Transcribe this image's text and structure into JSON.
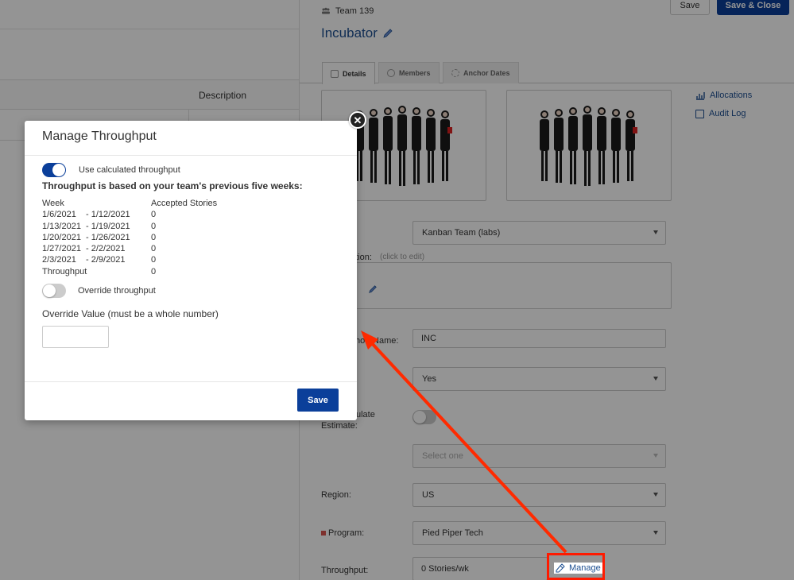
{
  "background": {
    "table_header": "Description"
  },
  "panel": {
    "team_label": "Team 139",
    "team_name": "Incubator",
    "save_label": "Save",
    "save_close_label": "Save & Close",
    "tabs": [
      {
        "label": "Details"
      },
      {
        "label": "Members"
      },
      {
        "label": "Anchor Dates"
      }
    ],
    "side_links": [
      {
        "label": "Allocations"
      },
      {
        "label": "Audit Log"
      }
    ],
    "team_type_value": "Kanban Team (labs)",
    "description_label_partial": "ption:",
    "description_hint": "(click to edit)",
    "description_value_partial": "or",
    "short_name_label_partial": "hort Name:",
    "short_name_value": "INC",
    "active_value": "Yes",
    "auto_calc_label_partial": "ulate",
    "auto_calc_label_line2": "Estimate:",
    "select_placeholder": "Select one",
    "region_label": "Region:",
    "region_value": "US",
    "program_label": "Program:",
    "program_value": "Pied Piper Tech",
    "throughput_label": "Throughput:",
    "throughput_value": "0 Stories/wk",
    "manage_label": "Manage"
  },
  "modal": {
    "title": "Manage Throughput",
    "close_glyph": "✕",
    "use_calc_label": "Use calculated throughput",
    "use_calc_on": true,
    "heading": "Throughput is based on your team's previous five weeks:",
    "columns": {
      "week": "Week",
      "accepted": "Accepted Stories"
    },
    "weeks": [
      {
        "start": "1/6/2021",
        "end": "- 1/12/2021",
        "accepted": "0"
      },
      {
        "start": "1/13/2021",
        "end": "- 1/19/2021",
        "accepted": "0"
      },
      {
        "start": "1/20/2021",
        "end": "- 1/26/2021",
        "accepted": "0"
      },
      {
        "start": "1/27/2021",
        "end": "- 2/2/2021",
        "accepted": "0"
      },
      {
        "start": "2/3/2021",
        "end": "- 2/9/2021",
        "accepted": "0"
      }
    ],
    "throughput_row": {
      "label": "Throughput",
      "value": "0"
    },
    "override_label": "Override throughput",
    "override_on": false,
    "override_value_label": "Override Value (must be a whole number)",
    "override_value": "",
    "save_label": "Save"
  },
  "colors": {
    "primary": "#0b3f9a",
    "link": "#1d4f91",
    "highlight": "#ff1a00"
  }
}
